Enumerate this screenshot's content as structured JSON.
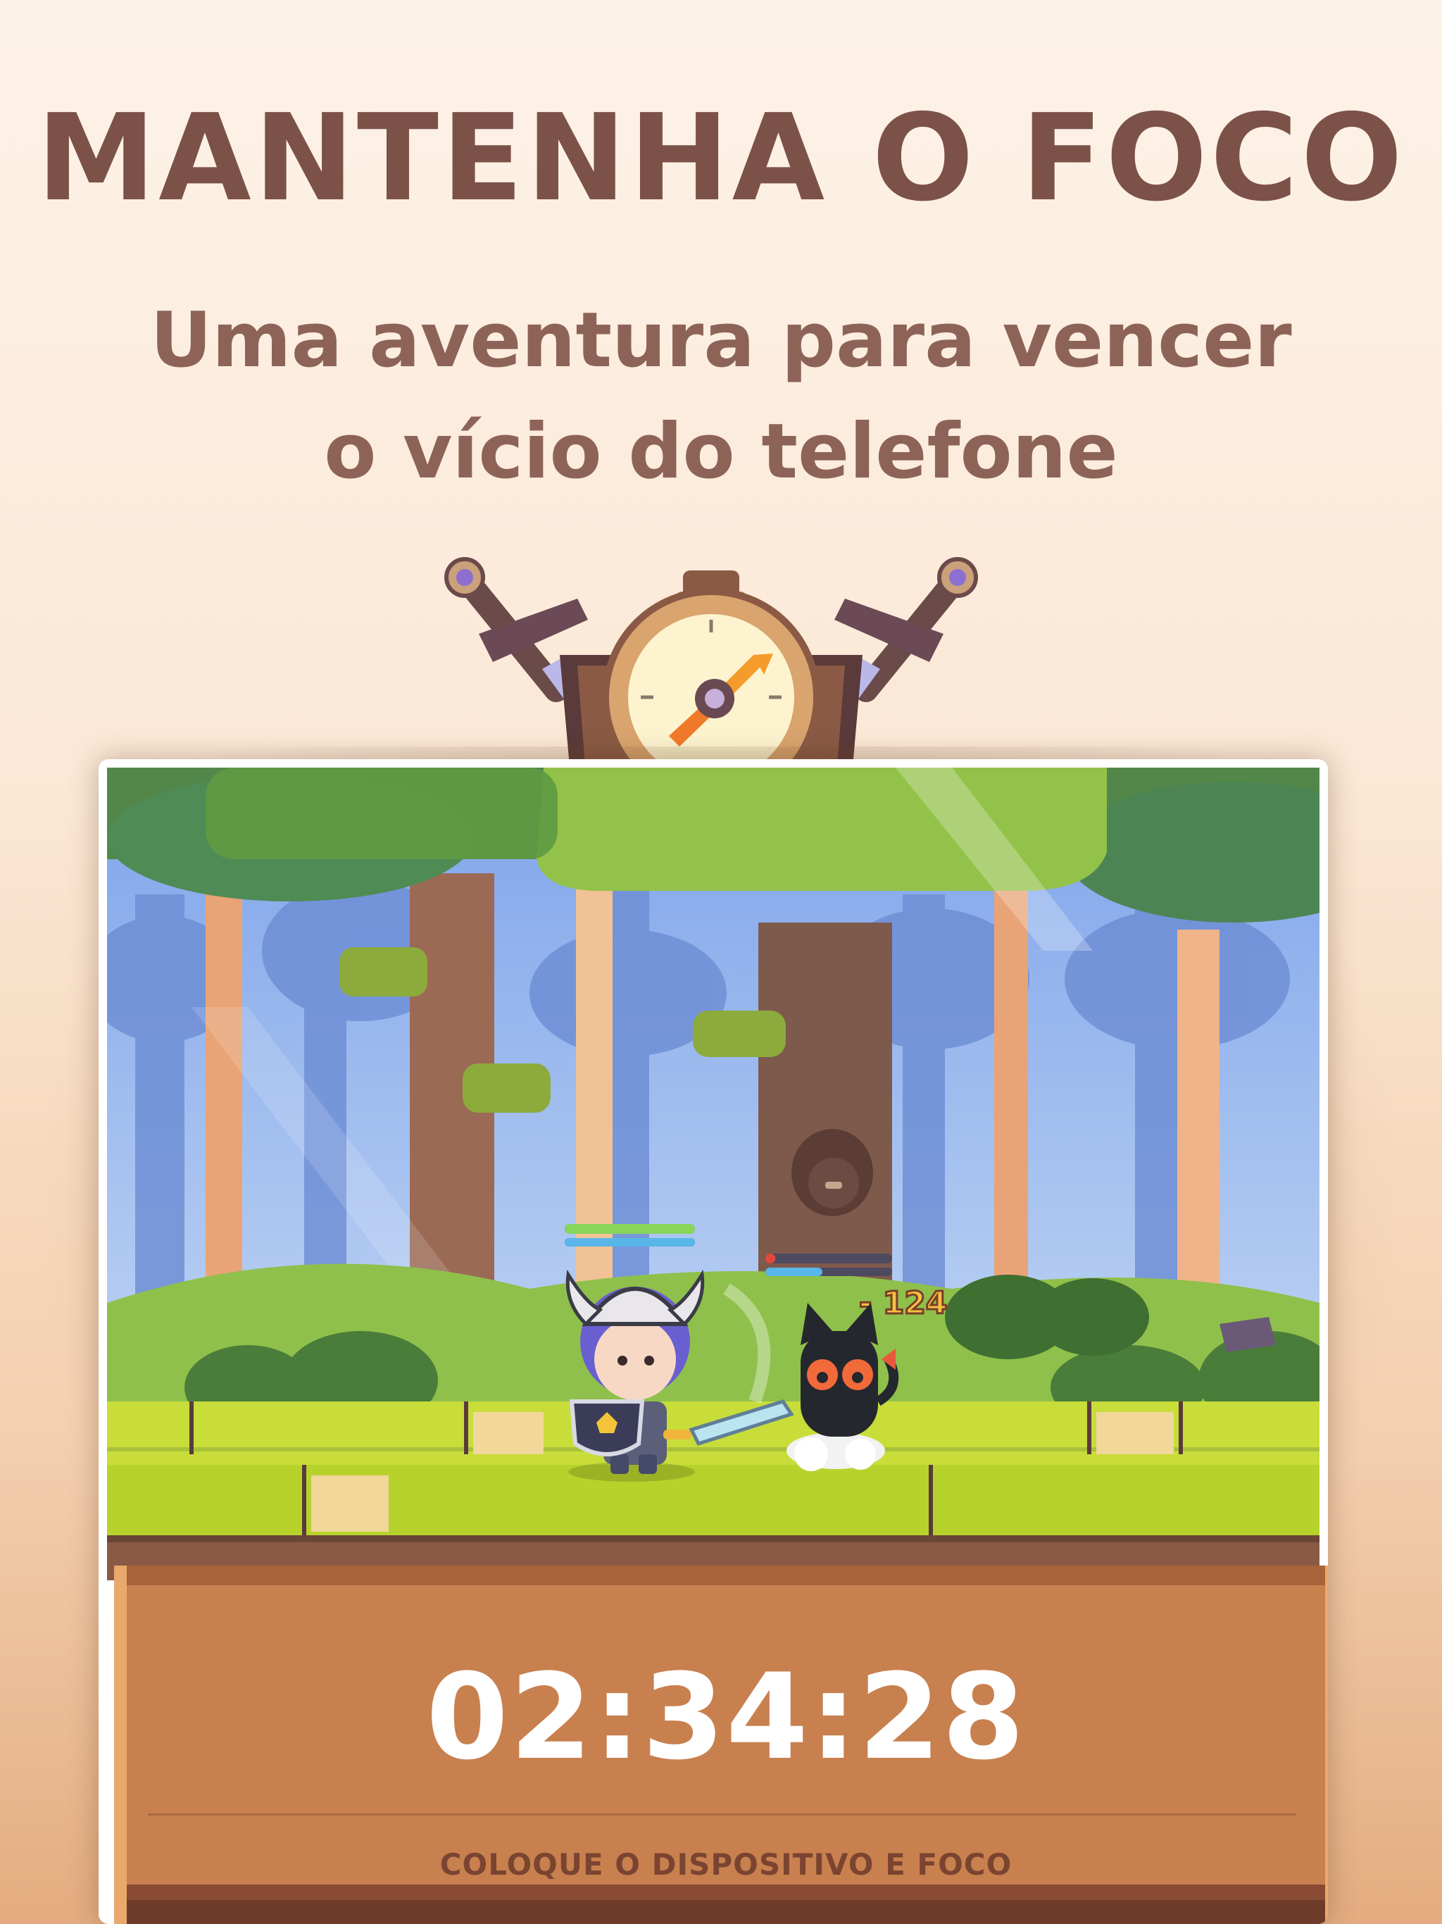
{
  "header": {
    "title": "MANTENHA O FOCO",
    "subtitle_line1": "Uma aventura para vencer",
    "subtitle_line2": "o vício do telefone"
  },
  "game": {
    "damage_text": "- 124",
    "player_hp": 1.0,
    "player_mp": 1.0,
    "enemy_hp": 0.08,
    "enemy_mp": 0.45
  },
  "timer_panel": {
    "timer": "02:34:28",
    "instruction": "COLOQUE O DISPOSITIVO E FOCO"
  },
  "colors": {
    "title": "#7b5148",
    "subtitle": "#8d6358",
    "panel": "#c8804f",
    "timer_text": "#ffffff",
    "instruction_text": "#7a4431"
  }
}
